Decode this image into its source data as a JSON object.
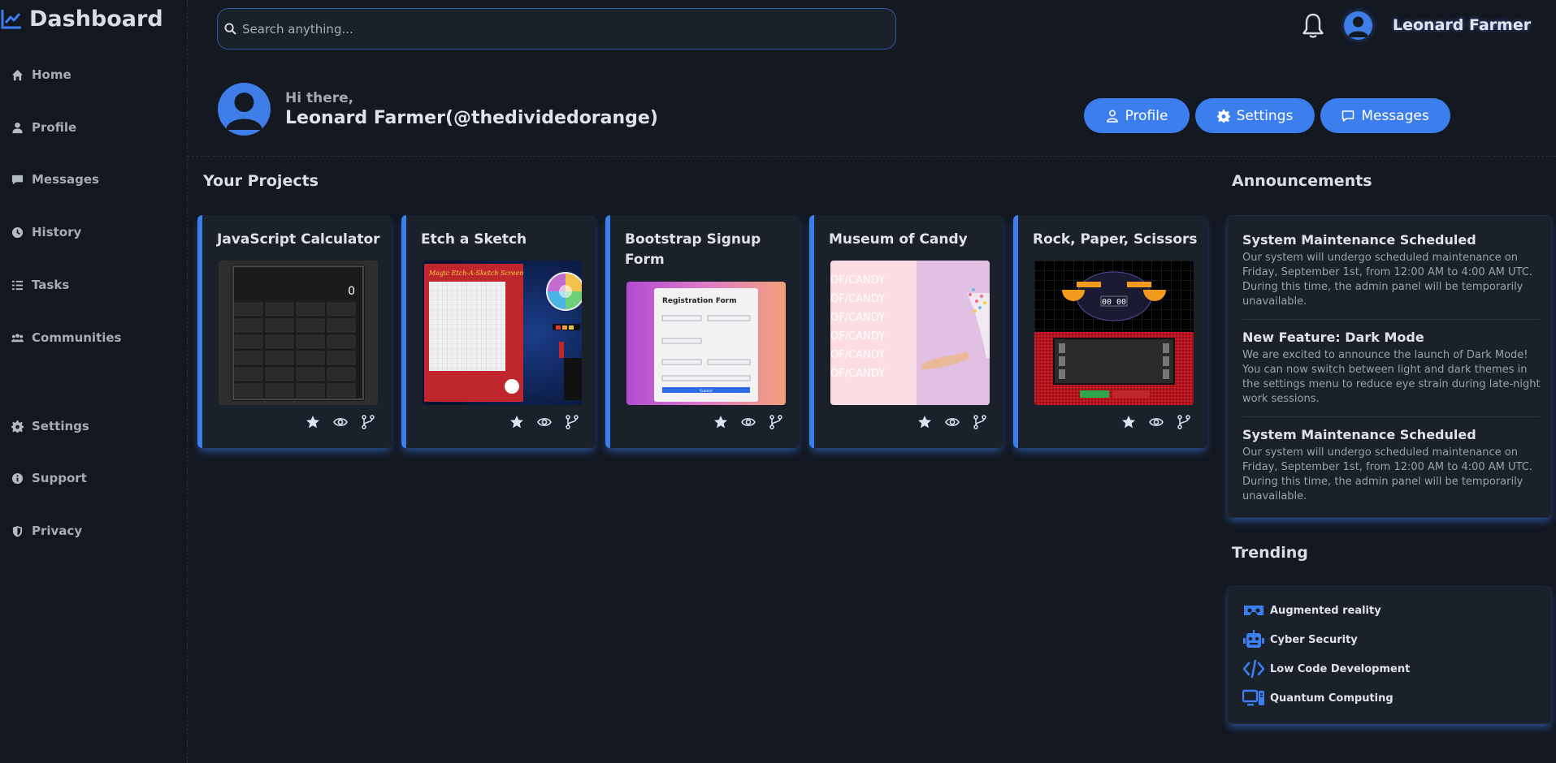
{
  "brand": {
    "title": "Dashboard"
  },
  "sidebar": {
    "items": [
      {
        "label": "Home",
        "icon": "home-icon"
      },
      {
        "label": "Profile",
        "icon": "user-icon"
      },
      {
        "label": "Messages",
        "icon": "message-icon"
      },
      {
        "label": "History",
        "icon": "clock-icon"
      },
      {
        "label": "Tasks",
        "icon": "list-icon"
      },
      {
        "label": "Communities",
        "icon": "users-icon"
      },
      {
        "label": "Settings",
        "icon": "gear-icon"
      },
      {
        "label": "Support",
        "icon": "info-icon"
      },
      {
        "label": "Privacy",
        "icon": "shield-icon"
      }
    ]
  },
  "header": {
    "search_placeholder": "Search anything...",
    "user_name": "Leonard Farmer"
  },
  "hero": {
    "greeting": "Hi there,",
    "name": "Leonard Farmer(@thedividedorange)",
    "buttons": {
      "profile": "Profile",
      "settings": "Settings",
      "messages": "Messages"
    }
  },
  "projects": {
    "title": "Your Projects",
    "items": [
      {
        "title": "JavaScript Calculator"
      },
      {
        "title": "Etch a Sketch",
        "thumb_caption": "Magic Etch-A-Sketch Screen"
      },
      {
        "title": "Bootstrap Signup Form",
        "thumb_caption": "Registration Form",
        "thumb_button": "Submit"
      },
      {
        "title": "Museum of Candy",
        "thumb_caption": "OF/CANDY"
      },
      {
        "title": "Rock, Paper, Scissors",
        "thumb_caption": "00 00"
      }
    ]
  },
  "announcements": {
    "title": "Announcements",
    "items": [
      {
        "title": "System Maintenance Scheduled",
        "body": "Our system will undergo scheduled maintenance on Friday, September 1st, from 12:00 AM to 4:00 AM UTC. During this time, the admin panel will be temporarily unavailable."
      },
      {
        "title": "New Feature: Dark Mode",
        "body": "We are excited to announce the launch of Dark Mode! You can now switch between light and dark themes in the settings menu to reduce eye strain during late-night work sessions."
      },
      {
        "title": "System Maintenance Scheduled",
        "body": "Our system will undergo scheduled maintenance on Friday, September 1st, from 12:00 AM to 4:00 AM UTC. During this time, the admin panel will be temporarily unavailable."
      }
    ]
  },
  "trending": {
    "title": "Trending",
    "items": [
      {
        "label": "Augmented reality",
        "icon": "vr-headset-icon"
      },
      {
        "label": "Cyber Security",
        "icon": "robot-icon"
      },
      {
        "label": "Low Code Development",
        "icon": "code-icon"
      },
      {
        "label": "Quantum Computing",
        "icon": "computer-icon"
      }
    ]
  },
  "colors": {
    "accent": "#3d7eee",
    "background": "#131821",
    "card": "#1b212b"
  }
}
